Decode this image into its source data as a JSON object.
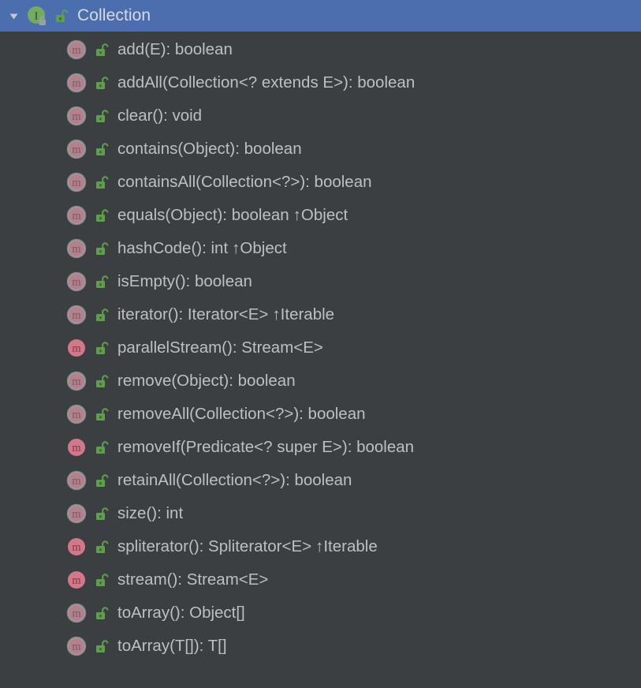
{
  "panel": {
    "background_color": "#3c3f41",
    "selected_row_color": "#4b6eaf",
    "text_color": "#bcc0c4",
    "inherited_text_color": "#7b8085",
    "public_icon_color": "#62a03f",
    "interface_icon_color": "#6aa84f",
    "method_icon_color": "#d1788a"
  },
  "root": {
    "twisty_icon": "triangle-down-icon",
    "twisty_state": "expanded",
    "type_icon": "interface-icon",
    "type_letter": "I",
    "badge_icon": "final-lock-badge-icon",
    "visibility_icon": "public-unlocked-padlock-icon",
    "label": "Collection"
  },
  "members": [
    {
      "icon": "abstract-method-icon",
      "visibility_icon": "public-unlocked-padlock-icon",
      "modifier": "abstract",
      "signature": "add(E): boolean",
      "inherited_from": ""
    },
    {
      "icon": "abstract-method-icon",
      "visibility_icon": "public-unlocked-padlock-icon",
      "modifier": "abstract",
      "signature": "addAll(Collection<? extends E>): boolean",
      "inherited_from": ""
    },
    {
      "icon": "abstract-method-icon",
      "visibility_icon": "public-unlocked-padlock-icon",
      "modifier": "abstract",
      "signature": "clear(): void",
      "inherited_from": ""
    },
    {
      "icon": "abstract-method-icon",
      "visibility_icon": "public-unlocked-padlock-icon",
      "modifier": "abstract",
      "signature": "contains(Object): boolean",
      "inherited_from": ""
    },
    {
      "icon": "abstract-method-icon",
      "visibility_icon": "public-unlocked-padlock-icon",
      "modifier": "abstract",
      "signature": "containsAll(Collection<?>): boolean",
      "inherited_from": ""
    },
    {
      "icon": "abstract-method-icon",
      "visibility_icon": "public-unlocked-padlock-icon",
      "modifier": "abstract",
      "signature": "equals(Object): boolean",
      "inherited_from": "↑Object"
    },
    {
      "icon": "abstract-method-icon",
      "visibility_icon": "public-unlocked-padlock-icon",
      "modifier": "abstract",
      "signature": "hashCode(): int",
      "inherited_from": "↑Object"
    },
    {
      "icon": "abstract-method-icon",
      "visibility_icon": "public-unlocked-padlock-icon",
      "modifier": "abstract",
      "signature": "isEmpty(): boolean",
      "inherited_from": ""
    },
    {
      "icon": "abstract-method-icon",
      "visibility_icon": "public-unlocked-padlock-icon",
      "modifier": "abstract",
      "signature": "iterator(): Iterator<E>",
      "inherited_from": "↑Iterable"
    },
    {
      "icon": "default-method-icon",
      "visibility_icon": "public-unlocked-padlock-icon",
      "modifier": "default",
      "signature": "parallelStream(): Stream<E>",
      "inherited_from": ""
    },
    {
      "icon": "abstract-method-icon",
      "visibility_icon": "public-unlocked-padlock-icon",
      "modifier": "abstract",
      "signature": "remove(Object): boolean",
      "inherited_from": ""
    },
    {
      "icon": "abstract-method-icon",
      "visibility_icon": "public-unlocked-padlock-icon",
      "modifier": "abstract",
      "signature": "removeAll(Collection<?>): boolean",
      "inherited_from": ""
    },
    {
      "icon": "default-method-icon",
      "visibility_icon": "public-unlocked-padlock-icon",
      "modifier": "default",
      "signature": "removeIf(Predicate<? super E>): boolean",
      "inherited_from": ""
    },
    {
      "icon": "abstract-method-icon",
      "visibility_icon": "public-unlocked-padlock-icon",
      "modifier": "abstract",
      "signature": "retainAll(Collection<?>): boolean",
      "inherited_from": ""
    },
    {
      "icon": "abstract-method-icon",
      "visibility_icon": "public-unlocked-padlock-icon",
      "modifier": "abstract",
      "signature": "size(): int",
      "inherited_from": ""
    },
    {
      "icon": "default-method-icon",
      "visibility_icon": "public-unlocked-padlock-icon",
      "modifier": "default",
      "signature": "spliterator(): Spliterator<E>",
      "inherited_from": "↑Iterable"
    },
    {
      "icon": "default-method-icon",
      "visibility_icon": "public-unlocked-padlock-icon",
      "modifier": "default",
      "signature": "stream(): Stream<E>",
      "inherited_from": ""
    },
    {
      "icon": "abstract-method-icon",
      "visibility_icon": "public-unlocked-padlock-icon",
      "modifier": "abstract",
      "signature": "toArray(): Object[]",
      "inherited_from": ""
    },
    {
      "icon": "abstract-method-icon",
      "visibility_icon": "public-unlocked-padlock-icon",
      "modifier": "abstract",
      "signature": "toArray(T[]): T[]",
      "inherited_from": ""
    }
  ]
}
